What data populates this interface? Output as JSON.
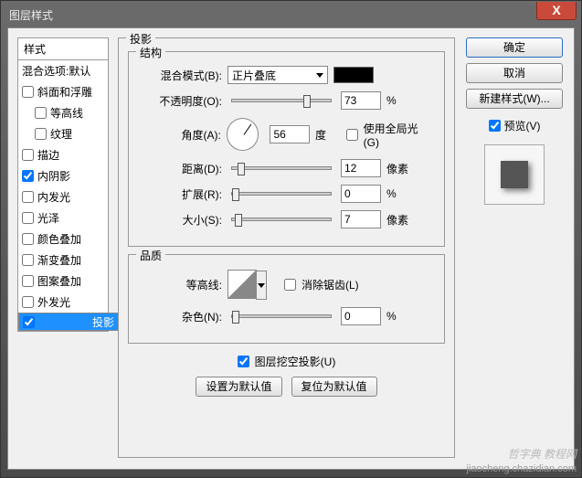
{
  "window": {
    "title": "图层样式",
    "close_x": "X"
  },
  "styles": {
    "header": "样式",
    "blend_default": "混合选项:默认",
    "items": [
      {
        "label": "斜面和浮雕",
        "checked": false,
        "sub": false
      },
      {
        "label": "等高线",
        "checked": false,
        "sub": true
      },
      {
        "label": "纹理",
        "checked": false,
        "sub": true
      },
      {
        "label": "描边",
        "checked": false,
        "sub": false
      },
      {
        "label": "内阴影",
        "checked": true,
        "sub": false
      },
      {
        "label": "内发光",
        "checked": false,
        "sub": false
      },
      {
        "label": "光泽",
        "checked": false,
        "sub": false
      },
      {
        "label": "颜色叠加",
        "checked": false,
        "sub": false
      },
      {
        "label": "渐变叠加",
        "checked": false,
        "sub": false
      },
      {
        "label": "图案叠加",
        "checked": false,
        "sub": false
      },
      {
        "label": "外发光",
        "checked": false,
        "sub": false
      },
      {
        "label": "投影",
        "checked": true,
        "sub": false,
        "selected": true
      }
    ]
  },
  "panel": {
    "title": "投影",
    "structure": {
      "legend": "结构",
      "blend_mode_label": "混合模式(B):",
      "blend_mode_value": "正片叠底",
      "color": "#000000",
      "opacity_label": "不透明度(O):",
      "opacity_value": "73",
      "opacity_unit": "%",
      "angle_label": "角度(A):",
      "angle_value": "56",
      "angle_unit": "度",
      "global_light_label": "使用全局光(G)",
      "global_light_checked": false,
      "distance_label": "距离(D):",
      "distance_value": "12",
      "distance_unit": "像素",
      "spread_label": "扩展(R):",
      "spread_value": "0",
      "spread_unit": "%",
      "size_label": "大小(S):",
      "size_value": "7",
      "size_unit": "像素"
    },
    "quality": {
      "legend": "品质",
      "contour_label": "等高线:",
      "antialias_label": "消除锯齿(L)",
      "antialias_checked": false,
      "noise_label": "杂色(N):",
      "noise_value": "0",
      "noise_unit": "%"
    },
    "knockout_label": "图层挖空投影(U)",
    "knockout_checked": true,
    "set_default": "设置为默认值",
    "reset_default": "复位为默认值"
  },
  "right": {
    "ok": "确定",
    "cancel": "取消",
    "new_style": "新建样式(W)...",
    "preview_label": "预览(V)",
    "preview_checked": true
  },
  "watermark": {
    "line1": "哲字典 教程网",
    "line2": "jiaocheng.chazidian.com"
  }
}
